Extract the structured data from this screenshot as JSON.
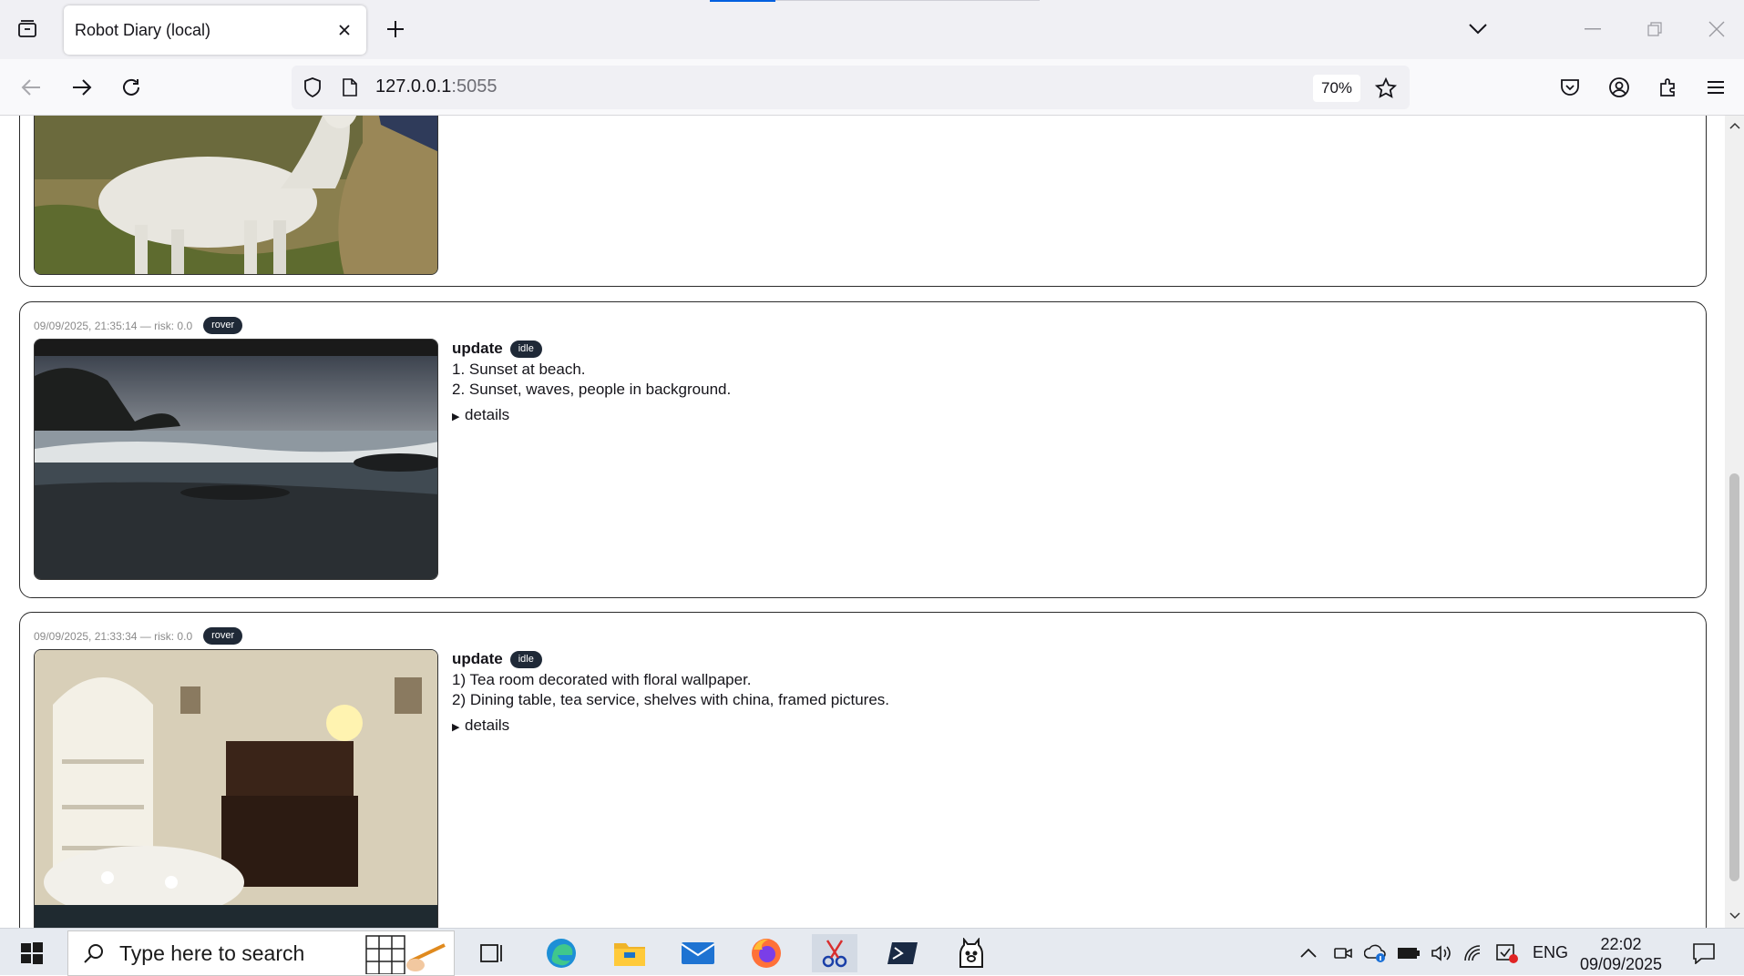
{
  "browser": {
    "tab_title": "Robot Diary (local)",
    "url_host": "127.0.0.1",
    "url_port": ":5055",
    "zoom": "70%"
  },
  "entries": [
    {
      "meta": "09/09/2025, 21:35:14 — risk: 0.0",
      "badge": "rover",
      "kind": "update",
      "status": "idle",
      "lines": [
        "1. Sunset at beach.",
        "2. Sunset, waves, people in background."
      ],
      "details_label": "details",
      "image": "beach-sunset-photo"
    },
    {
      "meta": "09/09/2025, 21:33:34 — risk: 0.0",
      "badge": "rover",
      "kind": "update",
      "status": "idle",
      "lines": [
        "1) Tea room decorated with floral wallpaper.",
        "2) Dining table, tea service, shelves with china, framed pictures."
      ],
      "details_label": "details",
      "image": "tea-room-photo"
    }
  ],
  "top_image": "alpaca-photo",
  "taskbar": {
    "search_placeholder": "Type here to search",
    "language": "ENG",
    "time": "22:02",
    "date": "09/09/2025"
  }
}
